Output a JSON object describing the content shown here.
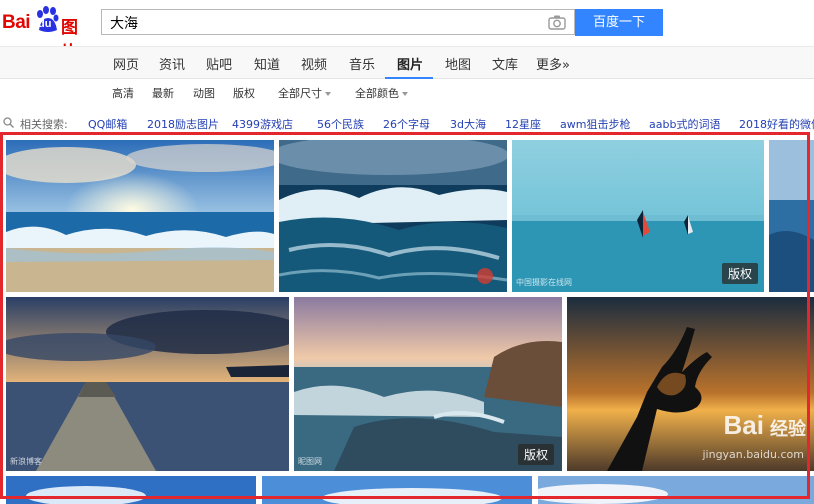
{
  "header": {
    "logo_bai": "Bai",
    "logo_du": "du",
    "logo_suffix": "图片",
    "search_value": "大海",
    "search_button": "百度一下"
  },
  "nav": {
    "items": [
      "网页",
      "资讯",
      "贴吧",
      "知道",
      "视频",
      "音乐",
      "图片",
      "地图",
      "文库",
      "更多»"
    ],
    "active": "图片"
  },
  "filters": [
    "高清",
    "最新",
    "动图",
    "版权",
    "全部尺寸",
    "全部颜色"
  ],
  "related": {
    "label": "相关搜索:",
    "links": [
      "QQ邮箱",
      "2018励志图片",
      "4399游戏店",
      "56个民族",
      "26个字母",
      "3d大海",
      "12星座",
      "awm狙击步枪",
      "aabb式的词语",
      "2018好看的微信"
    ]
  },
  "images": {
    "badge_label": "版权",
    "wm_3": "中国摄影在线网",
    "wm_4": "新浪博客",
    "wm_5": "昵图网",
    "jingyan_brand": "Bai",
    "jingyan_brand2": "经验",
    "jingyan_url": "jingyan.baidu.com"
  },
  "colors": {
    "brand_red": "#e10601",
    "brand_blue": "#3385ff",
    "link_blue": "#2440b3",
    "highlight_red": "#e3272d"
  }
}
